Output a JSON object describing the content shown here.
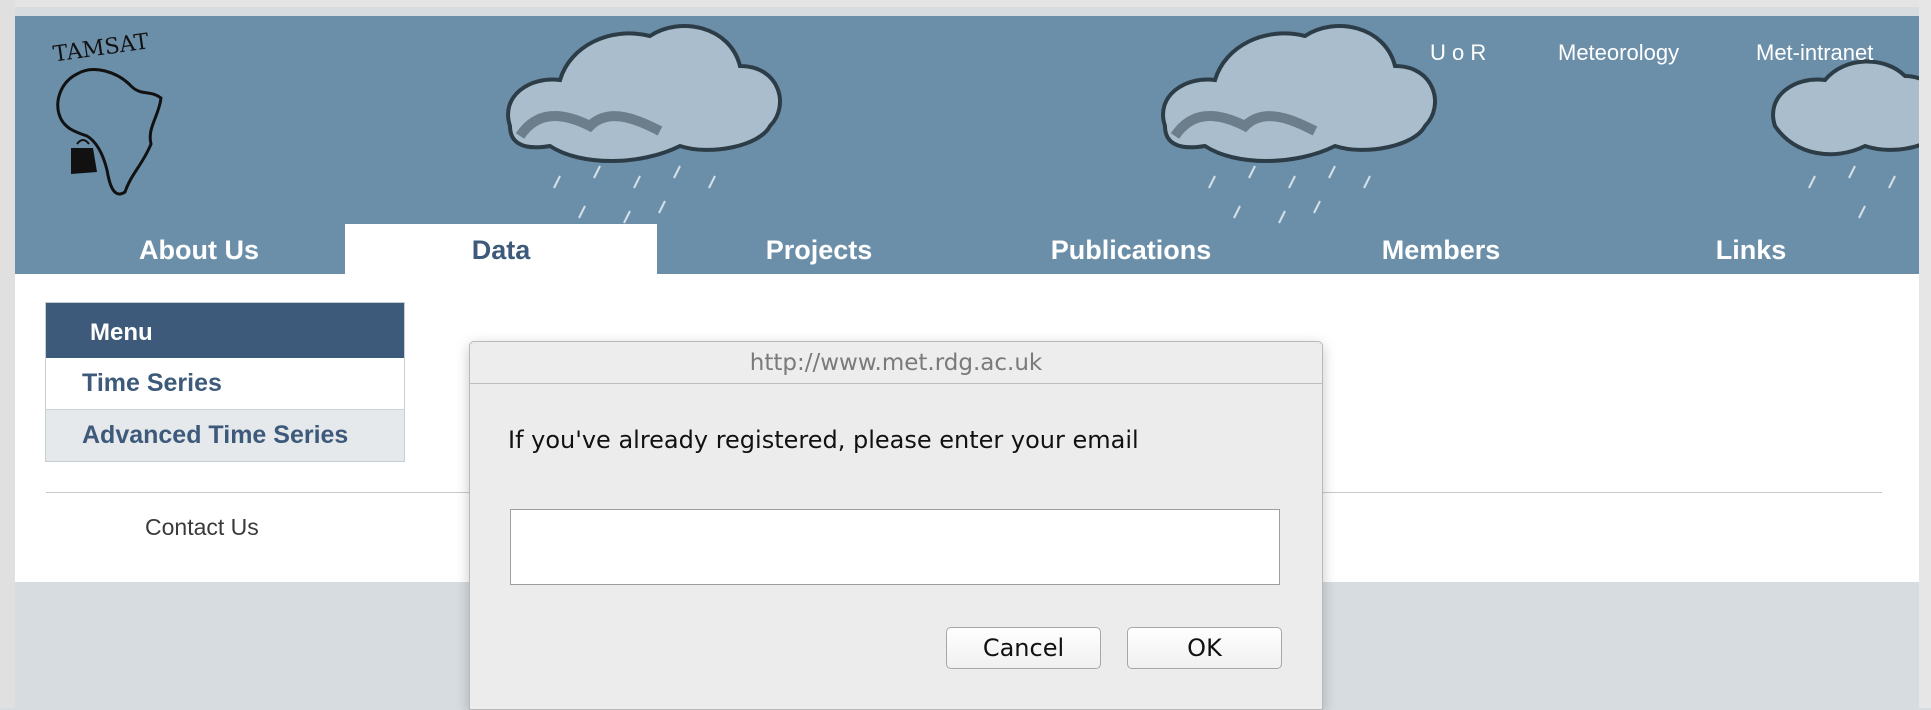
{
  "header": {
    "logo_text": "TAMSAT",
    "top_links": [
      "U o R",
      "Meteorology",
      "Met-intranet"
    ]
  },
  "nav": {
    "tabs": [
      "About Us",
      "Data",
      "Projects",
      "Publications",
      "Members",
      "Links"
    ],
    "active": "Data"
  },
  "sidebar": {
    "header": "Menu",
    "items": [
      "Time Series",
      "Advanced Time Series"
    ]
  },
  "footer": {
    "contact": "Contact Us"
  },
  "dialog": {
    "title": "http://www.met.rdg.ac.uk",
    "message": "If you've already registered, please enter your email",
    "input_value": "",
    "cancel_label": "Cancel",
    "ok_label": "OK"
  },
  "colors": {
    "banner": "#6c8fa9",
    "nav_text": "#ffffff",
    "menu_header": "#3d5a7a",
    "menu_text": "#3d5a7a"
  }
}
